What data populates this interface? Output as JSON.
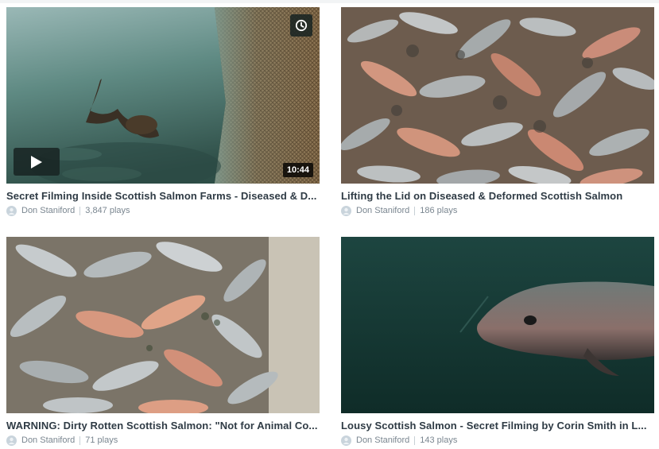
{
  "videos": [
    {
      "title": "Secret Filming Inside Scottish Salmon Farms - Diseased & D...",
      "author": "Don Staniford",
      "plays": "3,847 plays",
      "duration": "10:44",
      "icons": {
        "play": "play-icon",
        "watch_later": "clock-icon"
      }
    },
    {
      "title": "Lifting the Lid on Diseased & Deformed Scottish Salmon",
      "author": "Don Staniford",
      "plays": "186 plays"
    },
    {
      "title": "WARNING: Dirty Rotten Scottish Salmon: \"Not for Animal Co...",
      "author": "Don Staniford",
      "plays": "71 plays"
    },
    {
      "title": "Lousy Scottish Salmon - Secret Filming by Corin Smith in L...",
      "author": "Don Staniford",
      "plays": "143 plays"
    }
  ],
  "colors": {
    "title": "#2f3b45",
    "meta": "#7a8690",
    "overlay": "#172322"
  }
}
